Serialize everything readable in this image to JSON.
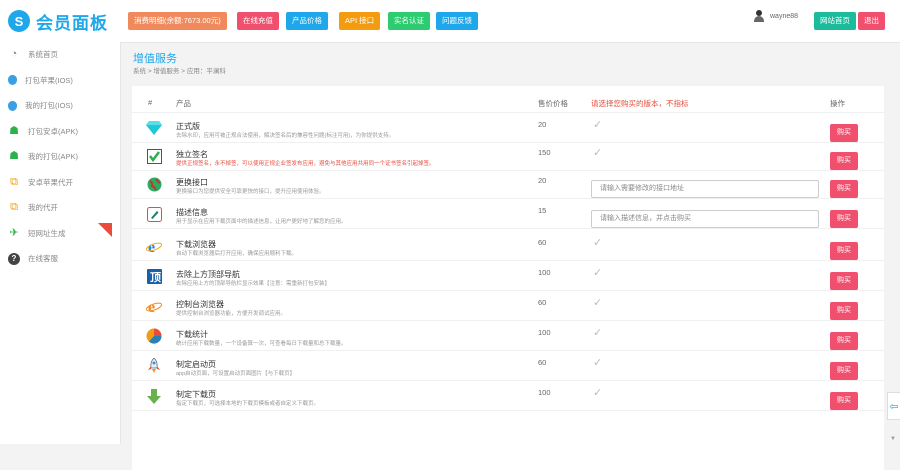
{
  "sidebar": {
    "logo_mark": "S",
    "logo_text": "会员面板",
    "items": [
      {
        "label": "系统首页",
        "icon": "dashboard-icon",
        "color": "#888888"
      },
      {
        "label": "打包苹果(IOS)",
        "icon": "apple-icon",
        "color": "#3aa0e6"
      },
      {
        "label": "我的打包(IOS)",
        "icon": "apple-icon",
        "color": "#3aa0e6"
      },
      {
        "label": "打包安卓(APK)",
        "icon": "android-icon",
        "color": "#2bb24c"
      },
      {
        "label": "我的打包(APK)",
        "icon": "android-icon",
        "color": "#2bb24c"
      },
      {
        "label": "安卓苹果代开",
        "icon": "copy-icon",
        "color": "#f39c12"
      },
      {
        "label": "我的代开",
        "icon": "copy-icon",
        "color": "#f39c12"
      },
      {
        "label": "短网址生成",
        "icon": "plane-icon",
        "color": "#2bb24c",
        "badge": "hot"
      },
      {
        "label": "在线客服",
        "icon": "question-icon",
        "color": "#444444"
      }
    ]
  },
  "topbar": {
    "buttons": [
      {
        "label": "消费明细(余额:7673.00元)",
        "color": "#f08a5d"
      },
      {
        "label": "在线充值",
        "color": "#f0506e"
      },
      {
        "label": "产品价格",
        "color": "#1ea7ea"
      },
      {
        "label": "API 接口",
        "color": "#f39c12"
      },
      {
        "label": "实名认证",
        "color": "#2ecc71"
      },
      {
        "label": "问题反馈",
        "color": "#1ea7ea"
      }
    ],
    "username": "wayne88",
    "home_label": "网站首页",
    "logout_label": "退出"
  },
  "page": {
    "title": "增值服务",
    "breadcrumb": [
      "系统",
      "增值服务",
      "应用：平澜科"
    ]
  },
  "table": {
    "headers": {
      "index": "#",
      "product": "产品",
      "price": "售价价格",
      "select": "请选择您购买的版本，不指标",
      "action": "操作"
    },
    "buy_label": "购买",
    "rows": [
      {
        "name": "正式版",
        "desc": "去除水印，应用可被正规合法使用，解决签名后的兼容性问题(标注可用)，为你提供支持。",
        "price": "20",
        "icon": "diamond-icon",
        "type": "check"
      },
      {
        "name": "独立签名",
        "desc": "提供正规签名，永不掉签，可以使用正规企业签发布应用，避免与其他应用共用同一个证书签名引起掉签。",
        "desc_red": true,
        "price": "150",
        "icon": "checkbox-icon",
        "type": "check"
      },
      {
        "name": "更换接口",
        "desc": "更换接口为您提供安全可靠更快的接口，提升应用使用体验。",
        "price": "20",
        "icon": "globe-icon",
        "type": "input",
        "placeholder": "请输入需要修改的接口地址"
      },
      {
        "name": "描述信息",
        "desc": "用于显示在应用下载页面中的描述信息，让用户更好地了解您的应用。",
        "price": "15",
        "icon": "edit-icon",
        "type": "input",
        "placeholder": "请输入描述信息，并点击购买"
      },
      {
        "name": "下载浏览器",
        "desc": "自动下载浏览器后打开应用，确保应用顺利下载。",
        "price": "60",
        "icon": "ie-icon",
        "type": "check"
      },
      {
        "name": "去除上方顶部导航",
        "desc": "去除应用上方的顶部导航栏显示效果【注意：需重新打包安装】",
        "price": "100",
        "icon": "top-icon",
        "type": "check"
      },
      {
        "name": "控制台浏览器",
        "desc": "提供控制台浏览器功能，方便开发调试应用。",
        "price": "60",
        "icon": "browser-icon",
        "type": "check"
      },
      {
        "name": "下载统计",
        "desc": "统计应用下载数量，一个设备算一次，可查看每日下载量和总下载量。",
        "price": "100",
        "icon": "pie-icon",
        "type": "check"
      },
      {
        "name": "制定启动页",
        "desc": "app启动页面，可设置启动页面图片【与下载页】",
        "price": "60",
        "icon": "rocket-icon",
        "type": "check"
      },
      {
        "name": "制定下载页",
        "desc": "指定下载页，可选择本地的下载页模板或者自定义下载页。",
        "price": "100",
        "icon": "download-icon",
        "type": "check"
      }
    ]
  }
}
